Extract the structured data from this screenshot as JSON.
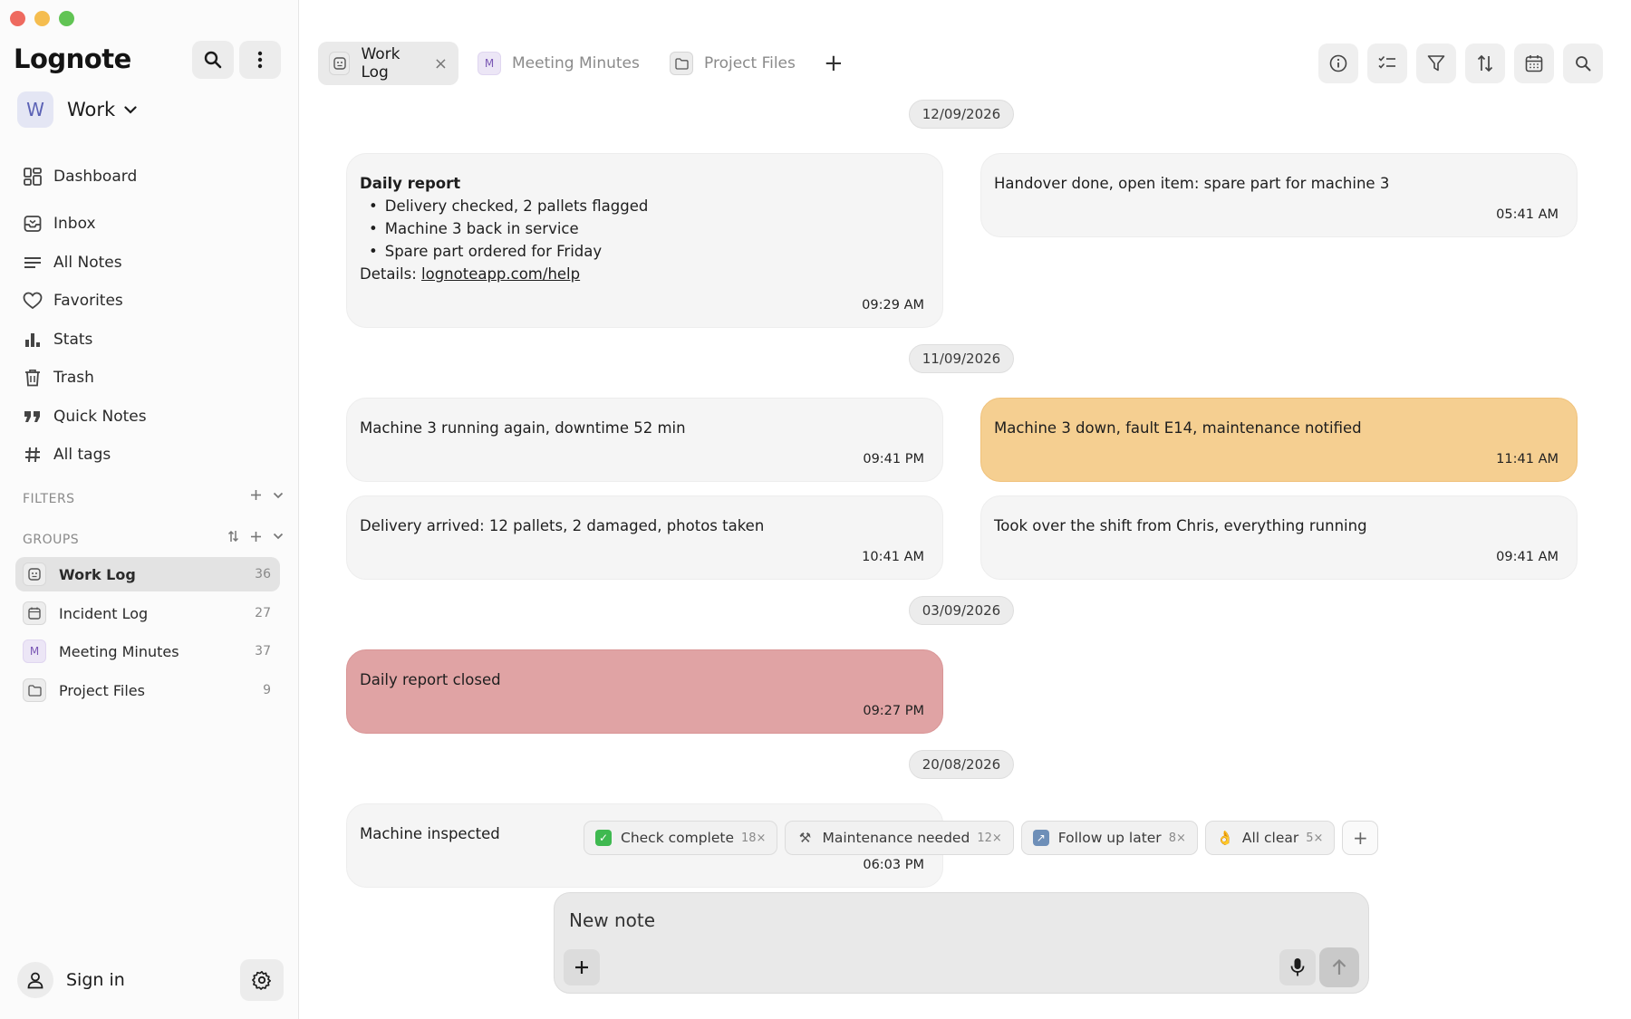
{
  "window": {
    "traffic_colors": [
      "#ee6a5f",
      "#f5bd4f",
      "#61c454"
    ]
  },
  "app": {
    "title": "Lognote"
  },
  "workspace": {
    "initial": "W",
    "name": "Work"
  },
  "nav": [
    {
      "label": "Dashboard",
      "icon": "dashboard-icon"
    },
    {
      "label": "Inbox",
      "icon": "inbox-icon"
    },
    {
      "label": "All Notes",
      "icon": "list-icon"
    },
    {
      "label": "Favorites",
      "icon": "heart-icon"
    },
    {
      "label": "Stats",
      "icon": "bar-chart-icon"
    },
    {
      "label": "Trash",
      "icon": "trash-icon"
    },
    {
      "label": "Quick Notes",
      "icon": "quote-icon"
    },
    {
      "label": "All tags",
      "icon": "hash-icon"
    }
  ],
  "filters": {
    "title": "FILTERS"
  },
  "groups": {
    "title": "GROUPS",
    "items": [
      {
        "label": "Work Log",
        "count": "36",
        "icon": "work-log-icon",
        "letter": ""
      },
      {
        "label": "Incident Log",
        "count": "27",
        "icon": "calendar-icon",
        "letter": ""
      },
      {
        "label": "Meeting Minutes",
        "count": "37",
        "icon": "letter-icon",
        "letter": "M"
      },
      {
        "label": "Project Files",
        "count": "9",
        "icon": "folder-icon",
        "letter": ""
      }
    ]
  },
  "account": {
    "sign_in": "Sign in"
  },
  "tabs": [
    {
      "label": "Work Log",
      "close": "×",
      "letter": ""
    },
    {
      "label": "Meeting Minutes",
      "letter": "M"
    },
    {
      "label": "Project Files",
      "letter": ""
    }
  ],
  "tab_add": "+",
  "toolbar_icons": [
    "info-icon",
    "checklist-icon",
    "filter-icon",
    "sort-icon",
    "calendar-icon",
    "search-icon"
  ],
  "dates": [
    "12/09/2026",
    "11/09/2026",
    "03/09/2026",
    "20/08/2026"
  ],
  "notes": {
    "daily_report": {
      "title": "Daily report",
      "bullets": [
        "Delivery checked, 2 pallets flagged",
        "Machine 3 back in service",
        "Spare part ordered for Friday"
      ],
      "details_label": "Details: ",
      "details_link": "lognoteapp.com/help",
      "time": "09:29 AM"
    },
    "handover": {
      "text": "Handover done, open item: spare part for machine 3",
      "time": "05:41 AM"
    },
    "running_again": {
      "text": "Machine 3 running again, downtime 52 min",
      "time": "09:41 PM"
    },
    "machine_down": {
      "text": "Machine 3 down, fault E14, maintenance notified",
      "time": "11:41 AM",
      "color": "#f5cf91"
    },
    "delivery": {
      "text": "Delivery arrived: 12 pallets, 2 damaged, photos taken",
      "time": "10:41 AM"
    },
    "took_over": {
      "text": "Took over the shift from Chris, everything running",
      "time": "09:41 AM"
    },
    "report_closed": {
      "text": "Daily report closed",
      "time": "09:27 PM",
      "color": "#e0a3a4"
    },
    "inspected": {
      "text": "Machine inspected",
      "time": "06:03 PM"
    }
  },
  "quick_tags": [
    {
      "emoji": "✓",
      "label": "Check complete",
      "count": "18×",
      "bg": "#3fb950"
    },
    {
      "emoji": "⚒",
      "label": "Maintenance needed",
      "count": "12×",
      "bg": "transparent"
    },
    {
      "emoji": "↗",
      "label": "Follow up later",
      "count": "8×",
      "bg": "#6e8fb8"
    },
    {
      "emoji": "👌",
      "label": "All clear",
      "count": "5×",
      "bg": "transparent"
    }
  ],
  "quick_tag_add": "+",
  "composer": {
    "placeholder": "New note"
  }
}
